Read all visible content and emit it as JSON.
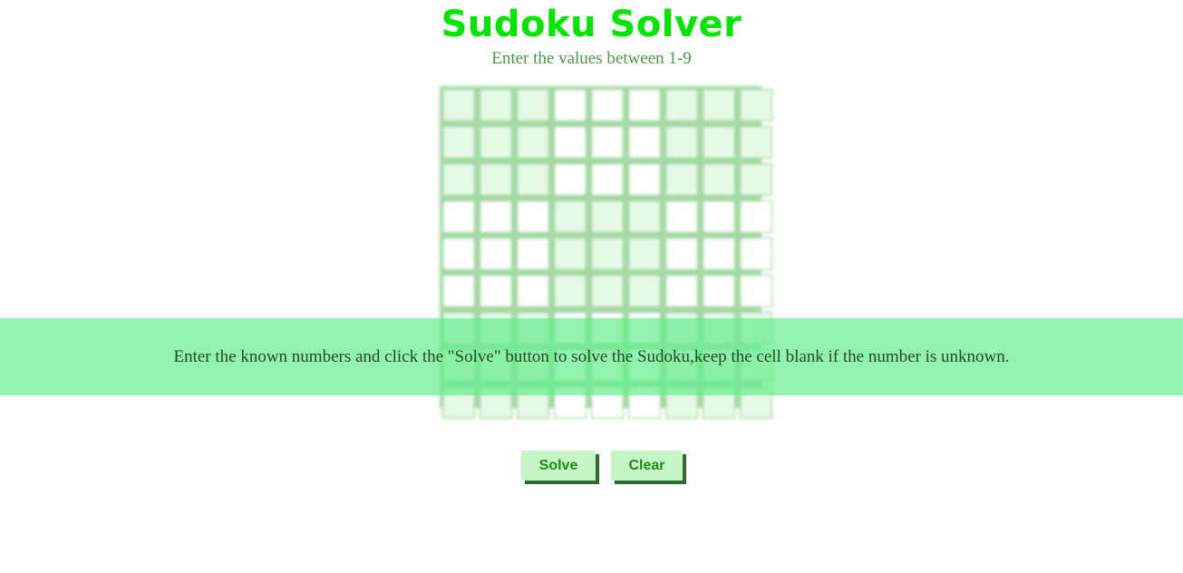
{
  "header": {
    "title": "Sudoku Solver",
    "subtitle": "Enter the values between 1-9"
  },
  "grid": {
    "rows": 9,
    "cols": 9,
    "values": [
      [
        "",
        "",
        "",
        "",
        "",
        "",
        "",
        "",
        ""
      ],
      [
        "",
        "",
        "",
        "",
        "",
        "",
        "",
        "",
        ""
      ],
      [
        "",
        "",
        "",
        "",
        "",
        "",
        "",
        "",
        ""
      ],
      [
        "",
        "",
        "",
        "",
        "",
        "",
        "",
        "",
        ""
      ],
      [
        "",
        "",
        "",
        "",
        "",
        "",
        "",
        "",
        ""
      ],
      [
        "",
        "",
        "",
        "",
        "",
        "",
        "",
        "",
        ""
      ],
      [
        "",
        "",
        "",
        "",
        "",
        "",
        "",
        "",
        ""
      ],
      [
        "",
        "",
        "",
        "",
        "",
        "",
        "",
        "",
        ""
      ],
      [
        "",
        "",
        "",
        "",
        "",
        "",
        "",
        "",
        ""
      ]
    ],
    "shaded_color": "#e6f8e6",
    "plain_color": "#ffffff"
  },
  "banner": {
    "text": "Enter the known numbers and click the \"Solve\" button to solve the Sudoku,keep the cell blank if the number is unknown."
  },
  "buttons": {
    "solve_label": "Solve",
    "clear_label": "Clear"
  },
  "colors": {
    "title": "#00e600",
    "subtitle": "#4a9a4a",
    "banner": "#64ee8c",
    "button_bg": "#c6f5c6",
    "button_text": "#1b8c1b"
  }
}
